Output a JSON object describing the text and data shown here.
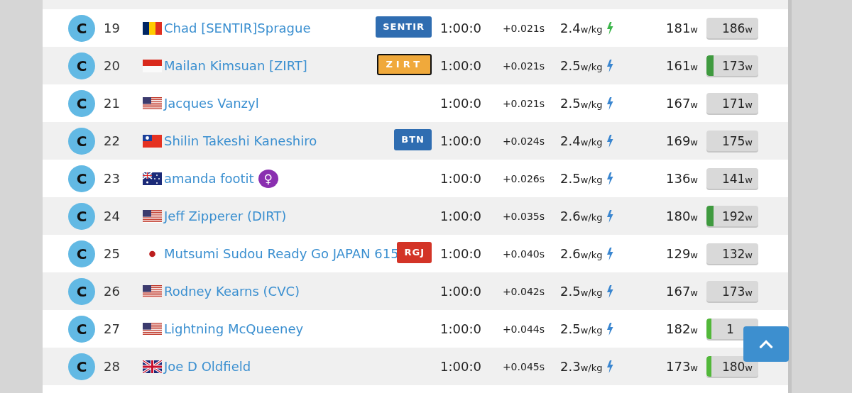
{
  "rows": [
    {
      "category": "C",
      "rank": "19",
      "flag": {
        "kind": "td"
      },
      "name": "Chad [SENTIR]Sprague",
      "female": false,
      "tag": {
        "text": "SENTIR",
        "color": "#2f6db1",
        "outlined": false
      },
      "time": "1:00:0",
      "gap": "+0.021s",
      "wkg": {
        "value": "2.4",
        "unit": "w/kg",
        "color": "#3bb54a"
      },
      "avg": {
        "value": "181",
        "unit": "w"
      },
      "power": {
        "value": "186",
        "unit": "w",
        "level": 0
      }
    },
    {
      "category": "C",
      "rank": "20",
      "flag": {
        "kind": "id"
      },
      "name": "Mailan Kimsuan [ZIRT]",
      "female": false,
      "tag": {
        "text": "ZIRT",
        "color": "#f0a93b",
        "outlined": true
      },
      "time": "1:00:0",
      "gap": "+0.021s",
      "wkg": {
        "value": "2.5",
        "unit": "w/kg",
        "color": "#3a86d0"
      },
      "avg": {
        "value": "161",
        "unit": "w"
      },
      "power": {
        "value": "173",
        "unit": "w",
        "level": 0.14,
        "color": "#3f9a3f"
      }
    },
    {
      "category": "C",
      "rank": "21",
      "flag": {
        "kind": "us"
      },
      "name": "Jacques Vanzyl",
      "female": false,
      "time": "1:00:0",
      "gap": "+0.021s",
      "wkg": {
        "value": "2.5",
        "unit": "w/kg",
        "color": "#3a86d0"
      },
      "avg": {
        "value": "167",
        "unit": "w"
      },
      "power": {
        "value": "171",
        "unit": "w",
        "level": 0
      }
    },
    {
      "category": "C",
      "rank": "22",
      "flag": {
        "kind": "tw"
      },
      "name": "Shilin Takeshi Kaneshiro",
      "female": false,
      "tag": {
        "text": "BTN",
        "color": "#2f6db1",
        "outlined": false
      },
      "time": "1:00:0",
      "gap": "+0.024s",
      "wkg": {
        "value": "2.4",
        "unit": "w/kg",
        "color": "#3a86d0"
      },
      "avg": {
        "value": "169",
        "unit": "w"
      },
      "power": {
        "value": "175",
        "unit": "w",
        "level": 0
      }
    },
    {
      "category": "C",
      "rank": "23",
      "flag": {
        "kind": "au"
      },
      "name": "amanda footit",
      "female": true,
      "female_sign": "♀",
      "time": "1:00:0",
      "gap": "+0.026s",
      "wkg": {
        "value": "2.5",
        "unit": "w/kg",
        "color": "#3a86d0"
      },
      "avg": {
        "value": "136",
        "unit": "w"
      },
      "power": {
        "value": "141",
        "unit": "w",
        "level": 0
      }
    },
    {
      "category": "C",
      "rank": "24",
      "flag": {
        "kind": "us"
      },
      "name": "Jeff Zipperer (DIRT)",
      "female": false,
      "time": "1:00:0",
      "gap": "+0.035s",
      "wkg": {
        "value": "2.6",
        "unit": "w/kg",
        "color": "#3a86d0"
      },
      "avg": {
        "value": "180",
        "unit": "w"
      },
      "power": {
        "value": "192",
        "unit": "w",
        "level": 0.14,
        "color": "#3f9a3f"
      }
    },
    {
      "category": "C",
      "rank": "25",
      "flag": {
        "kind": "jp"
      },
      "name": "Mutsumi Sudou Ready Go JAPAN 615",
      "female": false,
      "tag": {
        "text": "RGJ",
        "color": "#d33427",
        "outlined": false
      },
      "time": "1:00:0",
      "gap": "+0.040s",
      "wkg": {
        "value": "2.6",
        "unit": "w/kg",
        "color": "#3a86d0"
      },
      "avg": {
        "value": "129",
        "unit": "w"
      },
      "power": {
        "value": "132",
        "unit": "w",
        "level": 0
      }
    },
    {
      "category": "C",
      "rank": "26",
      "flag": {
        "kind": "us"
      },
      "name": "Rodney Kearns (CVC)",
      "female": false,
      "time": "1:00:0",
      "gap": "+0.042s",
      "wkg": {
        "value": "2.5",
        "unit": "w/kg",
        "color": "#3a86d0"
      },
      "avg": {
        "value": "167",
        "unit": "w"
      },
      "power": {
        "value": "173",
        "unit": "w",
        "level": 0
      }
    },
    {
      "category": "C",
      "rank": "27",
      "flag": {
        "kind": "us"
      },
      "name": "Lightning McQueeney",
      "female": false,
      "time": "1:00:0",
      "gap": "+0.044s",
      "wkg": {
        "value": "2.5",
        "unit": "w/kg",
        "color": "#3a86d0"
      },
      "avg": {
        "value": "182",
        "unit": "w"
      },
      "power": {
        "value": "1",
        "level": 0.1,
        "color": "#52b83a"
      }
    },
    {
      "category": "C",
      "rank": "28",
      "flag": {
        "kind": "gb"
      },
      "name": "Joe D Oldfield",
      "female": false,
      "time": "1:00:0",
      "gap": "+0.045s",
      "wkg": {
        "value": "2.3",
        "unit": "w/kg",
        "color": "#3a86d0"
      },
      "avg": {
        "value": "173",
        "unit": "w"
      },
      "power": {
        "value": "180",
        "unit": "w",
        "level": 0.1,
        "color": "#52b83a"
      }
    }
  ]
}
